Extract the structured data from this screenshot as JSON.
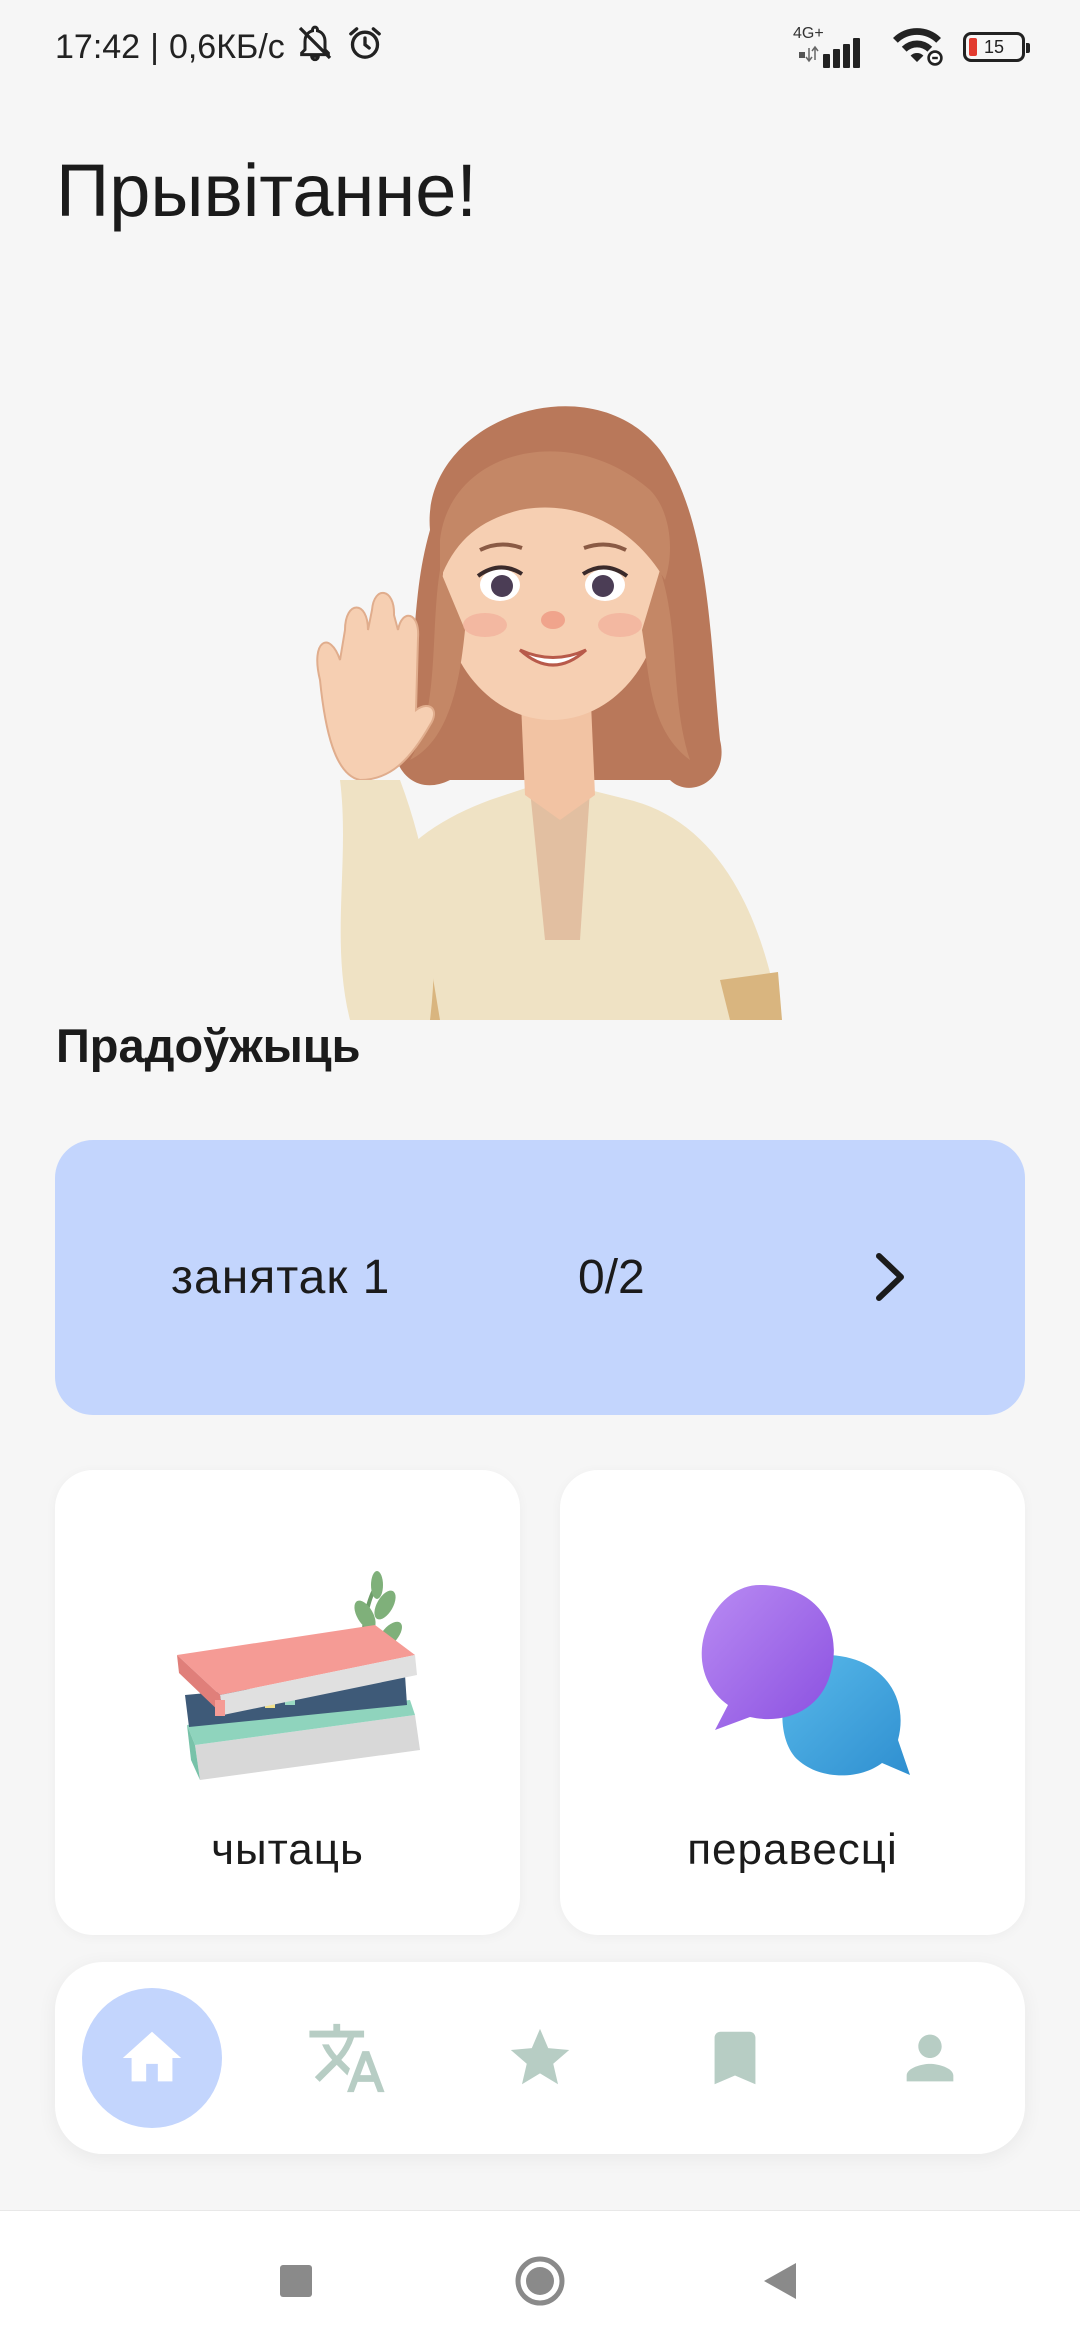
{
  "status_bar": {
    "time": "17:42",
    "separator": "|",
    "net_speed": "0,6КБ/с",
    "network_type": "4G+",
    "battery_level": "15",
    "icons": [
      "notifications-muted-icon",
      "alarm-icon",
      "signal-icon",
      "wifi-icon",
      "battery-icon"
    ]
  },
  "greeting": "Прывітанне!",
  "continue_section": {
    "title": "Прадоўжыць",
    "lesson": {
      "name": "занятак 1",
      "progress": "0/2"
    }
  },
  "tiles": [
    {
      "label": "чытаць",
      "icon": "books-icon"
    },
    {
      "label": "перавесці",
      "icon": "chat-bubbles-icon"
    }
  ],
  "bottom_nav": {
    "items": [
      {
        "icon": "home-icon",
        "active": true
      },
      {
        "icon": "translate-icon",
        "active": false
      },
      {
        "icon": "star-icon",
        "active": false
      },
      {
        "icon": "bookmark-icon",
        "active": false
      },
      {
        "icon": "profile-icon",
        "active": false
      }
    ]
  },
  "colors": {
    "background": "#f6f6f6",
    "accent": "#c3d5fd",
    "card": "#ffffff",
    "nav_icon_inactive": "#b7cdc4",
    "text": "#1b1b1b"
  }
}
